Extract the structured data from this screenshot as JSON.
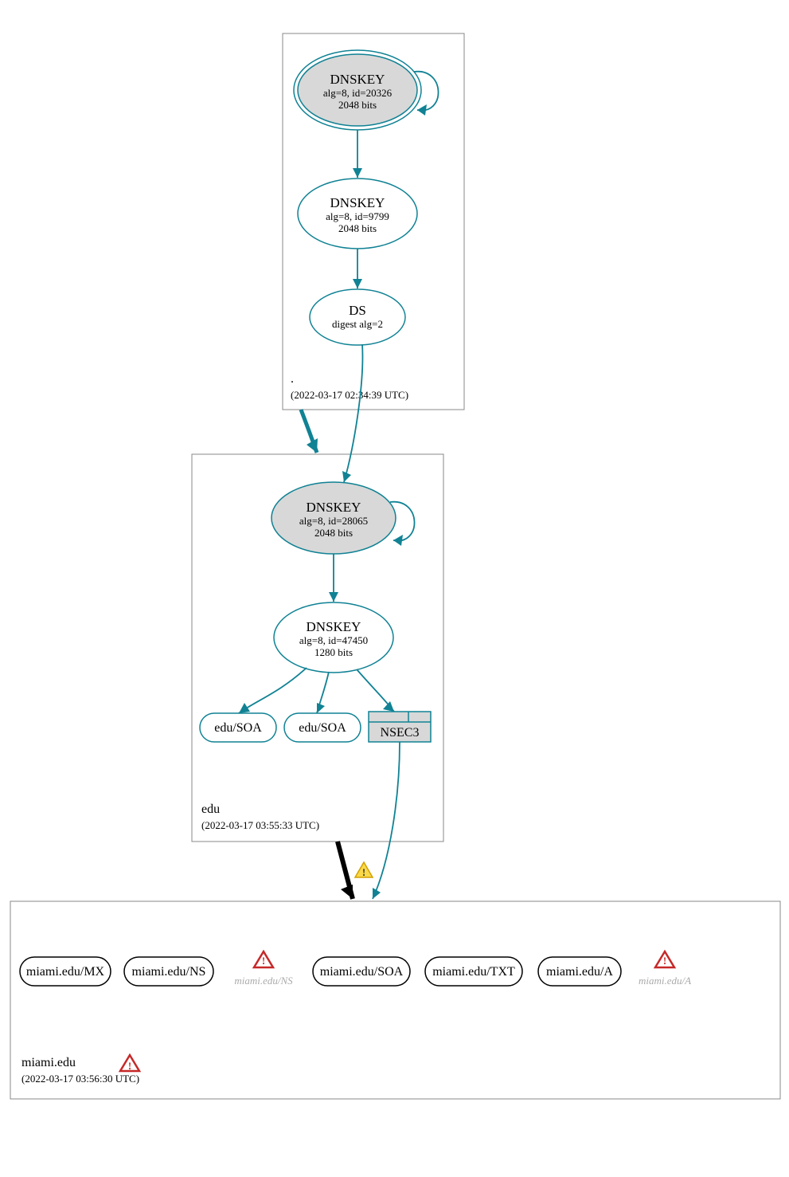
{
  "zones": {
    "root": {
      "name": ".",
      "timestamp": "(2022-03-17 02:34:39 UTC)",
      "dnskey1": {
        "title": "DNSKEY",
        "alg": "alg=8, id=20326",
        "bits": "2048 bits"
      },
      "dnskey2": {
        "title": "DNSKEY",
        "alg": "alg=8, id=9799",
        "bits": "2048 bits"
      },
      "ds": {
        "title": "DS",
        "digest": "digest alg=2"
      }
    },
    "edu": {
      "name": "edu",
      "timestamp": "(2022-03-17 03:55:33 UTC)",
      "dnskey1": {
        "title": "DNSKEY",
        "alg": "alg=8, id=28065",
        "bits": "2048 bits"
      },
      "dnskey2": {
        "title": "DNSKEY",
        "alg": "alg=8, id=47450",
        "bits": "1280 bits"
      },
      "soa1": "edu/SOA",
      "soa2": "edu/SOA",
      "nsec3": "NSEC3"
    },
    "miami": {
      "name": "miami.edu",
      "timestamp": "(2022-03-17 03:56:30 UTC)",
      "records": {
        "mx": "miami.edu/MX",
        "ns": "miami.edu/NS",
        "ns_warn": "miami.edu/NS",
        "soa": "miami.edu/SOA",
        "txt": "miami.edu/TXT",
        "a": "miami.edu/A",
        "a_warn": "miami.edu/A"
      }
    }
  },
  "icons": {
    "warning": "!",
    "error": "!"
  }
}
